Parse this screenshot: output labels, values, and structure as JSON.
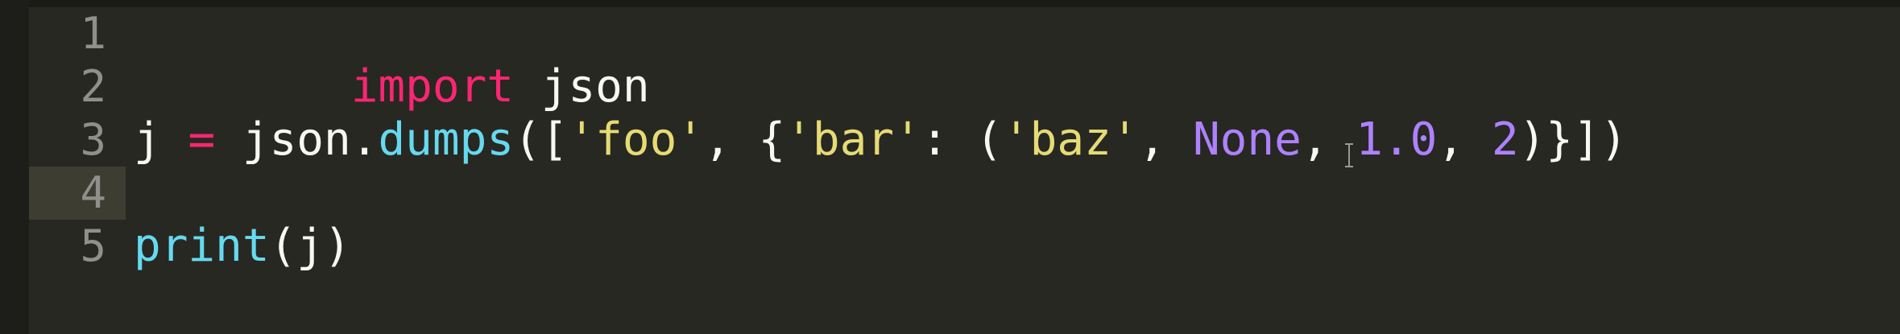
{
  "editor": {
    "lines": [
      {
        "number": "1",
        "tokens": [
          {
            "text": "import",
            "type": "kw"
          },
          {
            "text": " json",
            "type": "plain"
          }
        ]
      },
      {
        "number": "2",
        "tokens": []
      },
      {
        "number": "3",
        "tokens": [
          {
            "text": "j ",
            "type": "plain"
          },
          {
            "text": "=",
            "type": "op"
          },
          {
            "text": " json.",
            "type": "plain"
          },
          {
            "text": "dumps",
            "type": "fn"
          },
          {
            "text": "([",
            "type": "plain"
          },
          {
            "text": "'foo'",
            "type": "str"
          },
          {
            "text": ", {",
            "type": "plain"
          },
          {
            "text": "'bar'",
            "type": "str"
          },
          {
            "text": ": (",
            "type": "plain"
          },
          {
            "text": "'baz'",
            "type": "str"
          },
          {
            "text": ", ",
            "type": "plain"
          },
          {
            "text": "None",
            "type": "num"
          },
          {
            "text": ", ",
            "type": "plain"
          },
          {
            "text": "1.0",
            "type": "num"
          },
          {
            "text": ", ",
            "type": "plain"
          },
          {
            "text": "2",
            "type": "num"
          },
          {
            "text": ")}])",
            "type": "plain"
          }
        ]
      },
      {
        "number": "4",
        "tokens": [],
        "current": true
      },
      {
        "number": "5",
        "tokens": [
          {
            "text": "print",
            "type": "fn"
          },
          {
            "text": "(j)",
            "type": "plain"
          }
        ]
      }
    ]
  },
  "colors": {
    "background": "#272822",
    "current_line": "#3e3d32",
    "line_number": "#8f908a",
    "keyword": "#f92672",
    "function": "#66d9ef",
    "string": "#e6db74",
    "constant": "#ae81ff",
    "text": "#f8f8f2"
  },
  "icons": {
    "mouse_cursor": "ibeam-cursor-icon"
  }
}
